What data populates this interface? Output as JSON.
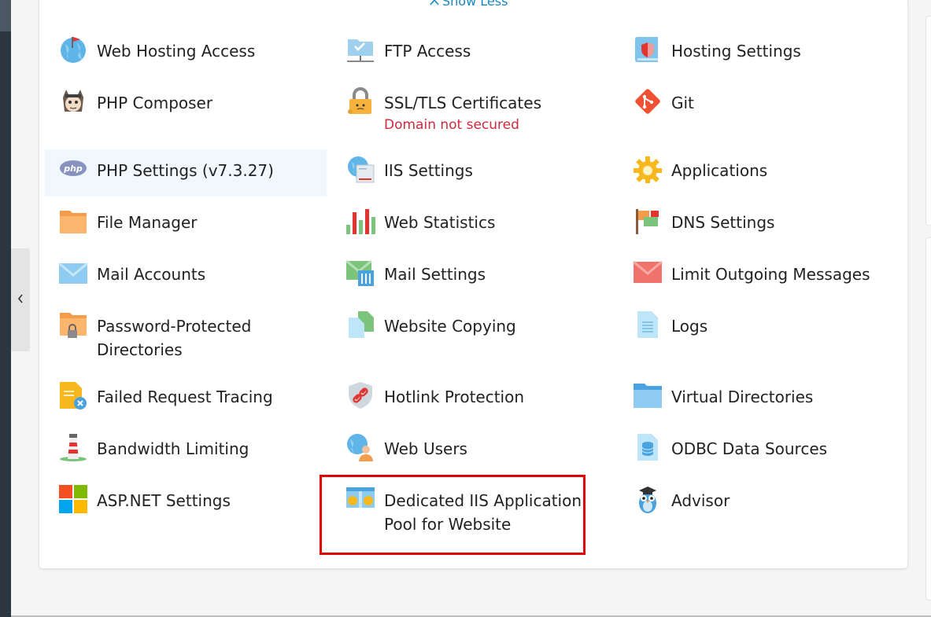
{
  "header": {
    "show_less_label": "Show Less"
  },
  "tools": {
    "web_hosting_access": "Web Hosting Access",
    "ftp_access": "FTP Access",
    "hosting_settings": "Hosting Settings",
    "php_composer": "PHP Composer",
    "ssl_tls": "SSL/TLS Certificates",
    "ssl_status": "Domain not secured",
    "git": "Git",
    "php_settings": "PHP Settings (v7.3.27)",
    "iis_settings": "IIS Settings",
    "applications": "Applications",
    "file_manager": "File Manager",
    "web_statistics": "Web Statistics",
    "dns_settings": "DNS Settings",
    "mail_accounts": "Mail Accounts",
    "mail_settings": "Mail Settings",
    "limit_outgoing": "Limit Outgoing Messages",
    "password_protected_1": "Password-Protected",
    "password_protected_2": "Directories",
    "website_copying": "Website Copying",
    "logs": "Logs",
    "failed_request": "Failed Request Tracing",
    "hotlink": "Hotlink Protection",
    "virtual_dirs": "Virtual Directories",
    "bandwidth": "Bandwidth Limiting",
    "web_users": "Web Users",
    "odbc": "ODBC Data Sources",
    "aspnet": "ASP.NET Settings",
    "dedicated_pool_1": "Dedicated IIS Application",
    "dedicated_pool_2": "Pool for Website",
    "advisor": "Advisor"
  },
  "colors": {
    "link": "#1587c4",
    "warning": "#d0293d",
    "highlight": "#e10000",
    "hover_bg": "#f1f8fd"
  }
}
